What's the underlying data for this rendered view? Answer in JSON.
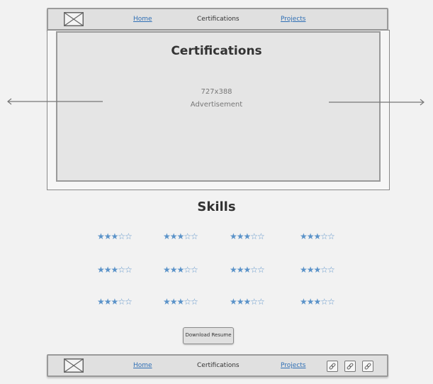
{
  "nav": {
    "home": "Home",
    "certifications": "Certifications",
    "projects": "Projects"
  },
  "carousel": {
    "title": "Certifications",
    "ad_size": "727x388",
    "ad_label": "Advertisement"
  },
  "skills": {
    "title": "Skills",
    "ratings": [
      "★★★☆☆",
      "★★★☆☆",
      "★★★☆☆",
      "★★★☆☆",
      "★★★☆☆",
      "★★★☆☆",
      "★★★☆☆",
      "★★★☆☆",
      "★★★☆☆",
      "★★★☆☆",
      "★★★☆☆",
      "★★★☆☆"
    ]
  },
  "download_label": "Download Resume",
  "icons": {
    "logo": "image-placeholder-icon",
    "social": [
      "link-icon",
      "link-icon",
      "link-icon"
    ],
    "left_arrow": "arrow-left-icon",
    "right_arrow": "arrow-right-icon"
  },
  "colors": {
    "link": "#2f6fb5",
    "stars": "#5b93c9"
  }
}
